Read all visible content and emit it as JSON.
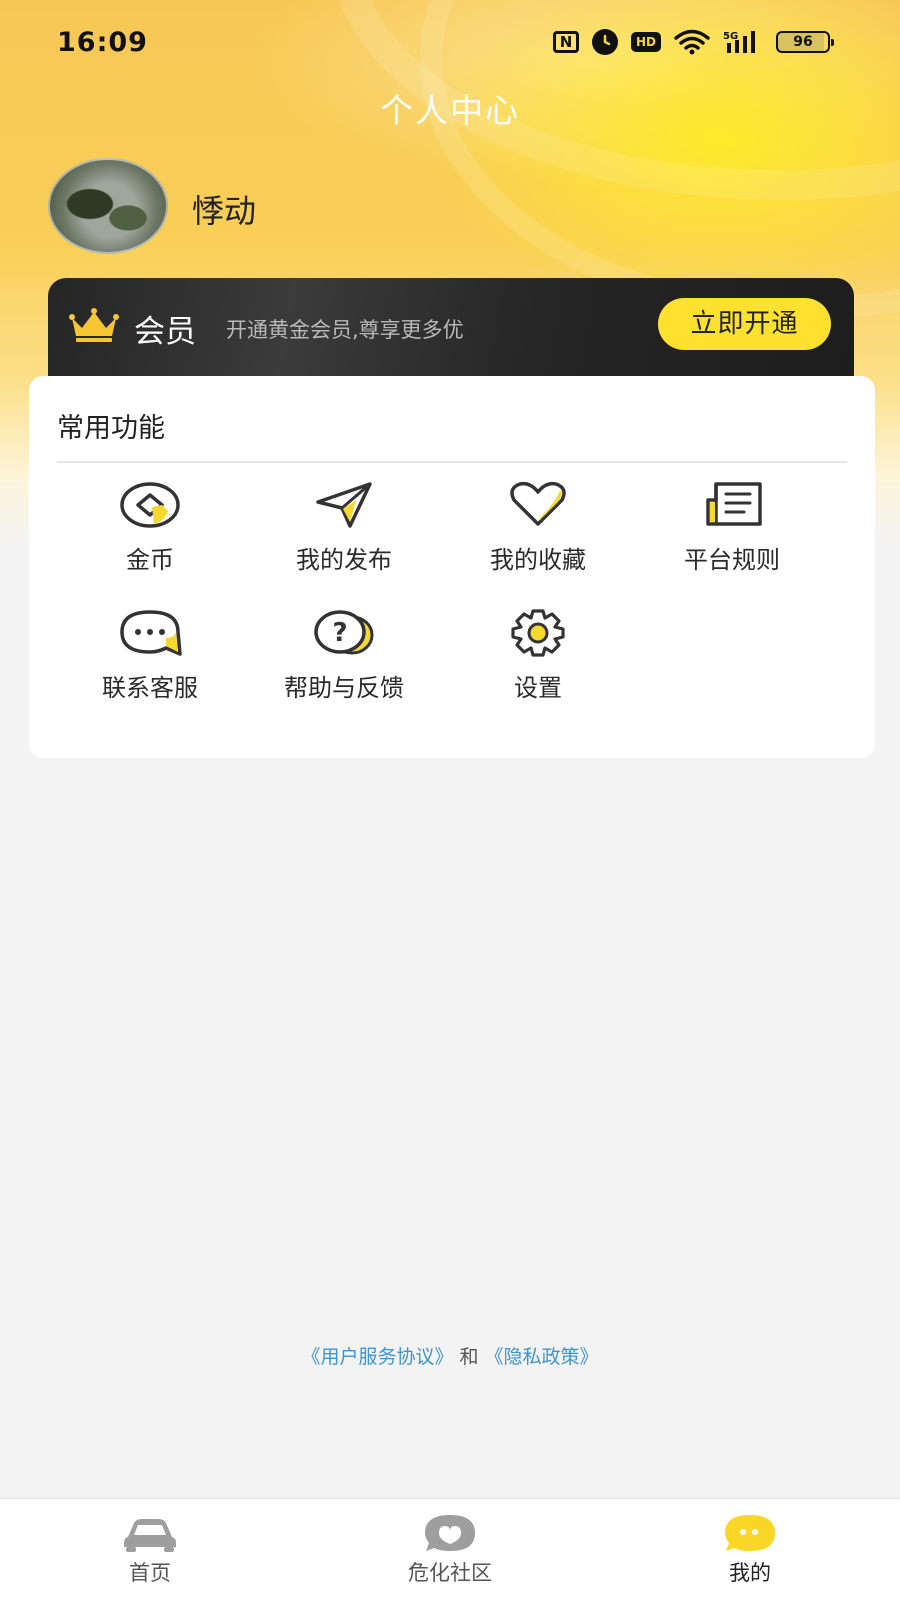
{
  "status_bar": {
    "time": "16:09",
    "nfc_icon_text": "N",
    "hd_icon_text": "HD",
    "network_label": "5G",
    "battery_level": "96"
  },
  "header": {
    "title": "个人中心"
  },
  "profile": {
    "username": "悸动"
  },
  "vip": {
    "label": "会员",
    "description": "开通黄金会员,尊享更多优",
    "button_label": "立即开通"
  },
  "functions": {
    "title": "常用功能",
    "items": [
      {
        "label": "金币",
        "icon": "coin-icon"
      },
      {
        "label": "我的发布",
        "icon": "send-icon"
      },
      {
        "label": "我的收藏",
        "icon": "heart-icon"
      },
      {
        "label": "平台规则",
        "icon": "document-icon"
      },
      {
        "label": "联系客服",
        "icon": "chat-icon"
      },
      {
        "label": "帮助与反馈",
        "icon": "help-icon"
      },
      {
        "label": "设置",
        "icon": "gear-icon"
      }
    ]
  },
  "legal": {
    "terms": "《用户服务协议》",
    "and": "和",
    "privacy": "《隐私政策》"
  },
  "tabbar": {
    "items": [
      {
        "label": "首页",
        "icon": "car-icon"
      },
      {
        "label": "危化社区",
        "icon": "community-chat-icon"
      },
      {
        "label": "我的",
        "icon": "profile-chat-icon",
        "active": true
      }
    ]
  },
  "colors": {
    "accent_yellow": "#fde12e",
    "link_blue": "#3f93cf",
    "vip_dark": "#262626"
  }
}
